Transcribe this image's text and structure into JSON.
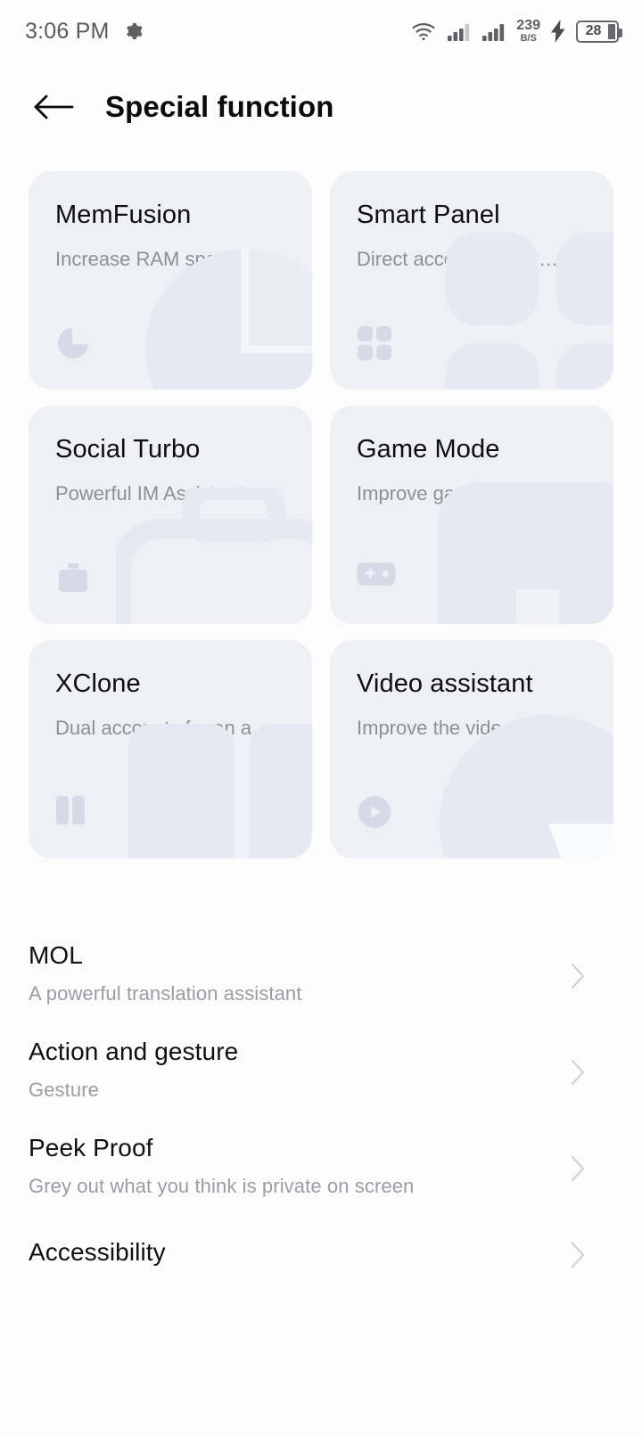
{
  "statusbar": {
    "time": "3:06 PM",
    "settings_icon": "gear-icon",
    "wifi_icon": "wifi-icon",
    "signal_icon_1": "signal-bars-icon",
    "signal_icon_2": "signal-bars-icon",
    "net_speed_value": "239",
    "net_speed_unit": "B/S",
    "charging_icon": "lightning-bolt-icon",
    "battery_level": "28"
  },
  "appbar": {
    "back_icon": "arrow-left-icon",
    "title": "Special function"
  },
  "cards": [
    {
      "title": "MemFusion",
      "subtitle": "Increase RAM space",
      "icon": "pie-chart-icon"
    },
    {
      "title": "Smart Panel",
      "subtitle": "Direct access to com…",
      "icon": "grid-four-icon"
    },
    {
      "title": "Social Turbo",
      "subtitle": "Powerful IM Assistant",
      "icon": "briefcase-icon"
    },
    {
      "title": "Game Mode",
      "subtitle": "Improve game experie…",
      "icon": "gamepad-icon"
    },
    {
      "title": "XClone",
      "subtitle": "Dual accounts for an a…",
      "icon": "dual-columns-icon"
    },
    {
      "title": "Video assistant",
      "subtitle": "Improve the video vie…",
      "icon": "play-circle-icon"
    }
  ],
  "list": [
    {
      "title": "MOL",
      "subtitle": "A powerful translation assistant",
      "chevron": "chevron-right-icon"
    },
    {
      "title": "Action and gesture",
      "subtitle": "Gesture",
      "chevron": "chevron-right-icon"
    },
    {
      "title": "Peek Proof",
      "subtitle": "Grey out what you think is private on screen",
      "chevron": "chevron-right-icon"
    },
    {
      "title": "Accessibility",
      "subtitle": "",
      "chevron": "chevron-right-icon"
    }
  ],
  "colors": {
    "page_bg": "#fcfcfd",
    "card_bg": "#eef0f5",
    "card_icon": "#d6dae6",
    "watermark": "#e6e9f1",
    "title_text": "#0d0d0f",
    "subtitle_text": "#8e9096",
    "list_subtitle": "#9b9da2",
    "status_text": "#5b5b5f"
  }
}
